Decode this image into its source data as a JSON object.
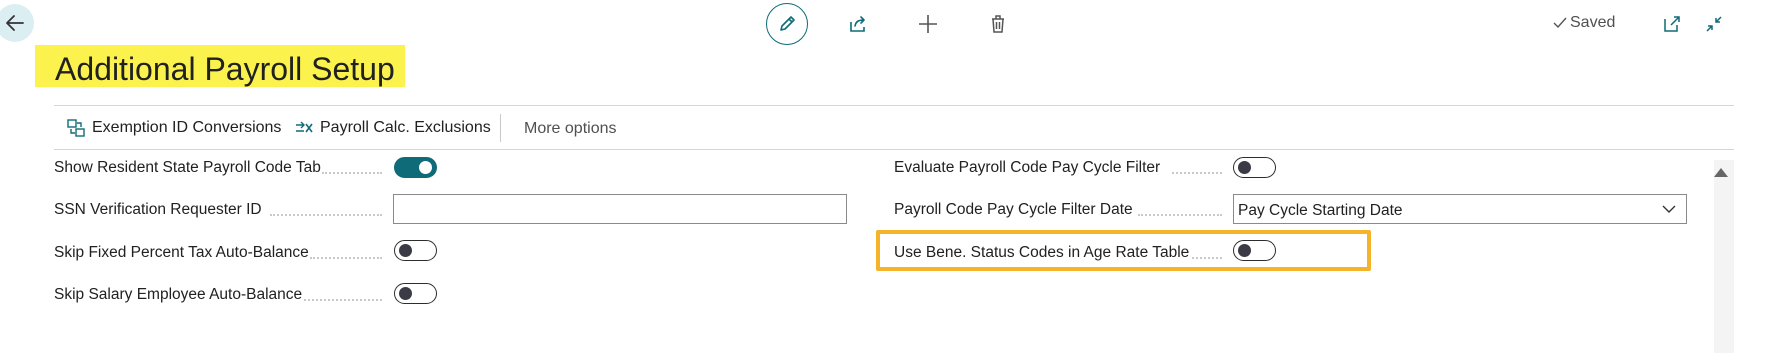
{
  "header": {
    "saved_label": "Saved"
  },
  "page": {
    "title": "Additional Payroll Setup"
  },
  "actions": {
    "exemption": "Exemption ID Conversions",
    "exclusions": "Payroll Calc. Exclusions",
    "more": "More options"
  },
  "fields_left": [
    {
      "label": "Show Resident State Payroll Code Tab",
      "type": "toggle",
      "value": true
    },
    {
      "label": "SSN Verification Requester ID",
      "type": "text",
      "value": ""
    },
    {
      "label": "Skip Fixed Percent Tax Auto-Balance",
      "type": "toggle",
      "value": false
    },
    {
      "label": "Skip Salary Employee Auto-Balance",
      "type": "toggle",
      "value": false
    }
  ],
  "fields_right": [
    {
      "label": "Evaluate Payroll Code Pay Cycle Filter",
      "type": "toggle",
      "value": false
    },
    {
      "label": "Payroll Code Pay Cycle Filter Date",
      "type": "select",
      "value": "Pay Cycle Starting Date"
    },
    {
      "label": "Use Bene. Status Codes in Age Rate Table",
      "type": "toggle",
      "value": false
    }
  ],
  "colors": {
    "accent": "#0f6b78",
    "title_highlight": "#fcf24d",
    "field_highlight": "#f5b32a"
  }
}
